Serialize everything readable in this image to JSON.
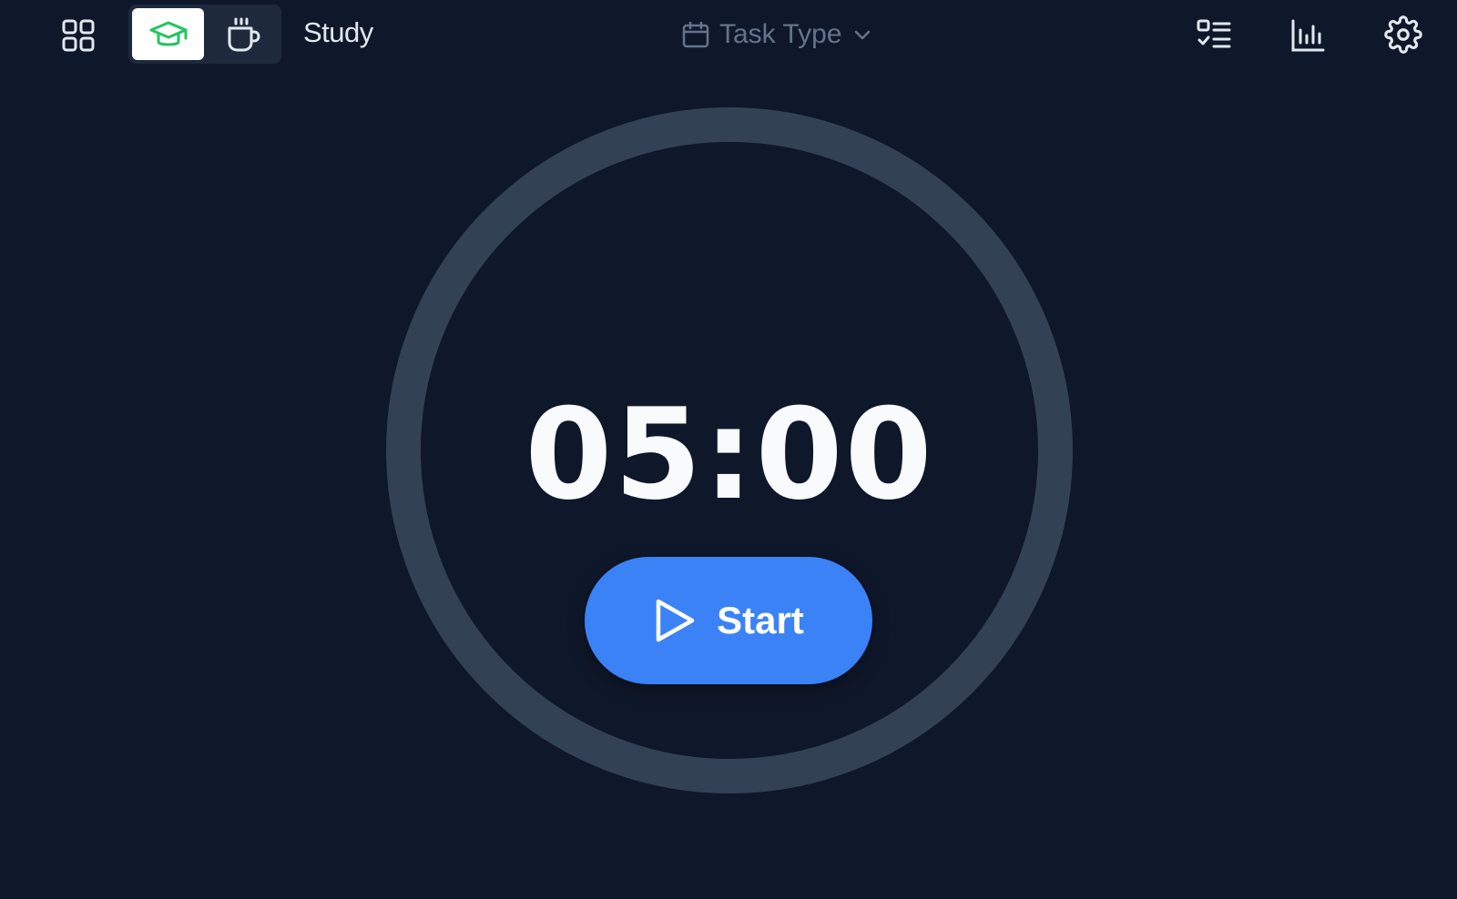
{
  "header": {
    "mode_label": "Study",
    "task_type_label": "Task Type",
    "modes": [
      {
        "name": "study",
        "icon": "graduation-cap-icon",
        "active": true
      },
      {
        "name": "break",
        "icon": "coffee-cup-icon",
        "active": false
      }
    ]
  },
  "timer": {
    "display": "05:00",
    "start_label": "Start",
    "progress": 0
  },
  "colors": {
    "background": "#0f172a",
    "ring": "#334155",
    "accent": "#3b82f6",
    "study_icon": "#22c55e"
  },
  "icons": [
    "apps-grid-icon",
    "graduation-cap-icon",
    "coffee-cup-icon",
    "calendar-icon",
    "chevron-down-icon",
    "task-list-icon",
    "bar-chart-icon",
    "gear-icon",
    "play-icon"
  ]
}
